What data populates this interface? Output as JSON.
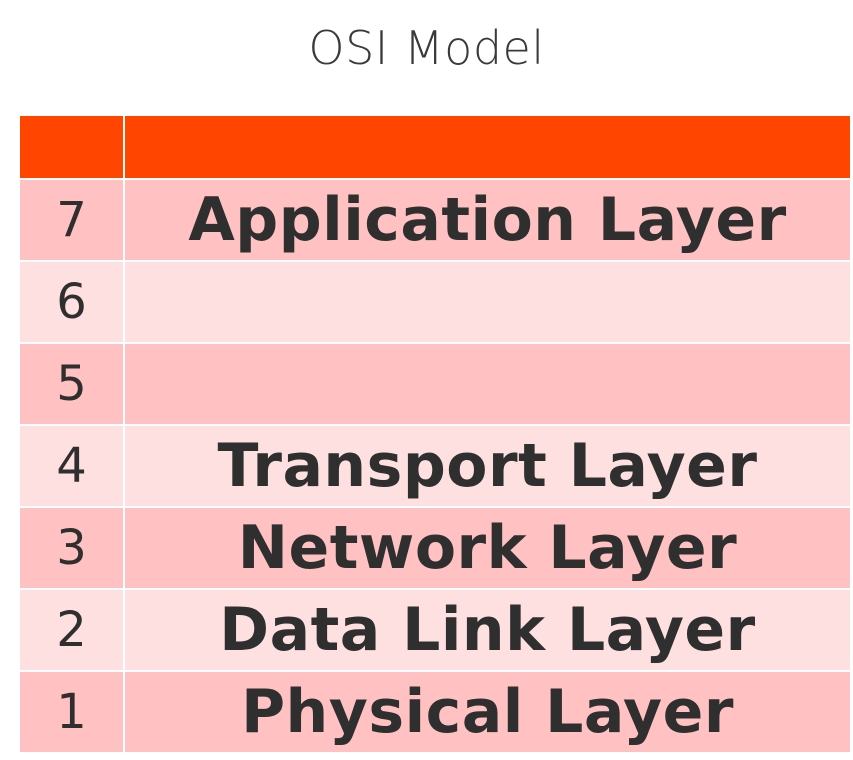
{
  "title": "OSI Model",
  "table": {
    "header": [
      "",
      ""
    ],
    "rows": [
      {
        "number": "7",
        "name": "Application Layer"
      },
      {
        "number": "6",
        "name": ""
      },
      {
        "number": "5",
        "name": ""
      },
      {
        "number": "4",
        "name": "Transport Layer"
      },
      {
        "number": "3",
        "name": "Network Layer"
      },
      {
        "number": "2",
        "name": "Data Link Layer"
      },
      {
        "number": "1",
        "name": "Physical Layer"
      }
    ]
  },
  "colors": {
    "header": "#ff4500",
    "row_dark": "#ffc1c1",
    "row_light": "#ffe0e0",
    "text": "#2f2f2f"
  }
}
